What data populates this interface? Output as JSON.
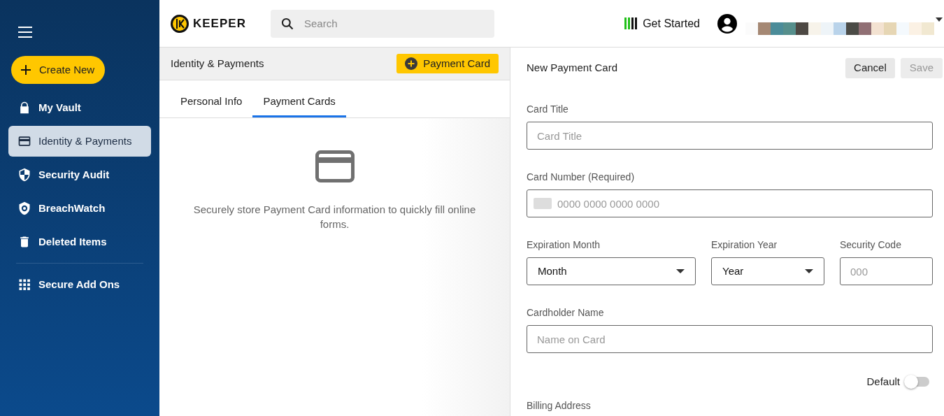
{
  "sidebar": {
    "create_button": "Create New",
    "items": [
      {
        "label": "My Vault",
        "selected": false
      },
      {
        "label": "Identity & Payments",
        "selected": true
      },
      {
        "label": "Security Audit",
        "selected": false
      },
      {
        "label": "BreachWatch",
        "selected": false
      },
      {
        "label": "Deleted Items",
        "selected": false
      },
      {
        "label": "Secure Add Ons",
        "selected": false
      }
    ]
  },
  "header": {
    "logo": "KEEPER",
    "search": {
      "placeholder": "Search"
    },
    "get_started": "Get Started"
  },
  "list_panel": {
    "title": "Identity & Payments",
    "add_button": "Payment Card",
    "tabs": [
      {
        "label": "Personal Info",
        "selected": false
      },
      {
        "label": "Payment Cards",
        "selected": true
      }
    ],
    "empty_message": "Securely store Payment Card information to quickly fill online forms."
  },
  "form": {
    "title": "New Payment Card",
    "cancel": "Cancel",
    "save": {
      "label": "Save",
      "disabled": true
    },
    "card_title": {
      "label": "Card Title",
      "placeholder": "Card Title"
    },
    "card_number": {
      "label": "Card Number (Required)",
      "placeholder": "0000 0000 0000 0000"
    },
    "expiration_month": {
      "label": "Expiration Month",
      "value": "Month"
    },
    "expiration_year": {
      "label": "Expiration Year",
      "value": "Year"
    },
    "security_code": {
      "label": "Security Code",
      "placeholder": "000"
    },
    "cardholder_name": {
      "label": "Cardholder Name",
      "placeholder": "Name on Card"
    },
    "default": {
      "label": "Default",
      "on": false
    },
    "billing_address": "Billing Address"
  }
}
